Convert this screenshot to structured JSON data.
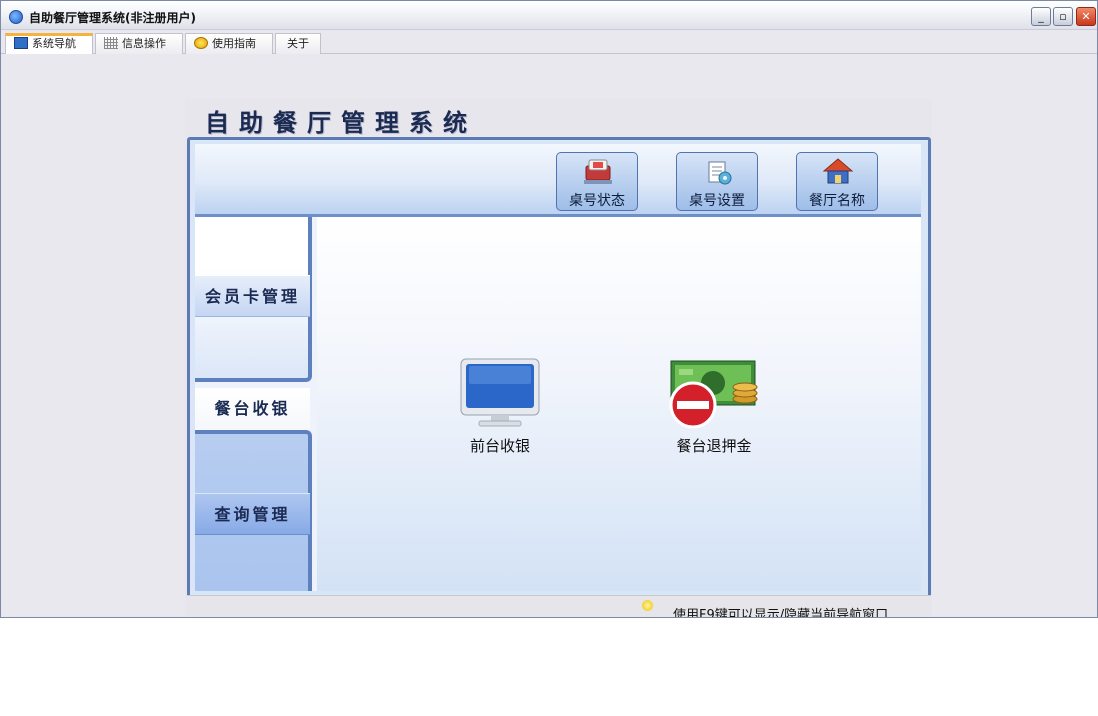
{
  "window": {
    "title": "自助餐厅管理系统(非注册用户)",
    "minimize_glyph": "_",
    "maximize_glyph": "▫",
    "close_glyph": "✕"
  },
  "tabs": [
    {
      "label": "系统导航",
      "icon": "monitor-icon",
      "active": true
    },
    {
      "label": "信息操作",
      "icon": "grid-icon",
      "active": false
    },
    {
      "label": "使用指南",
      "icon": "bulb-icon",
      "active": false
    },
    {
      "label": "关于",
      "icon": "",
      "active": false
    }
  ],
  "header": {
    "title": "自助餐厅管理系统"
  },
  "toolbar": {
    "buttons": [
      {
        "label": "桌号状态",
        "icon": "table-status-icon"
      },
      {
        "label": "桌号设置",
        "icon": "table-settings-icon"
      },
      {
        "label": "餐厅名称",
        "icon": "restaurant-name-icon"
      }
    ]
  },
  "sidebar": {
    "items": [
      {
        "label": "会员卡管理"
      },
      {
        "label": "餐台收银",
        "active": true
      },
      {
        "label": "查询管理"
      }
    ]
  },
  "main": {
    "functions": [
      {
        "label": "前台收银",
        "icon": "monitor-icon"
      },
      {
        "label": "餐台退押金",
        "icon": "money-refund-icon"
      }
    ]
  },
  "status": {
    "text": "使用F9键可以显示/隐藏当前导航窗口"
  },
  "colors": {
    "frame_blue": "#5c7bb5",
    "tab_active_accent": "#f4b33c",
    "close_red": "#c8381a"
  }
}
